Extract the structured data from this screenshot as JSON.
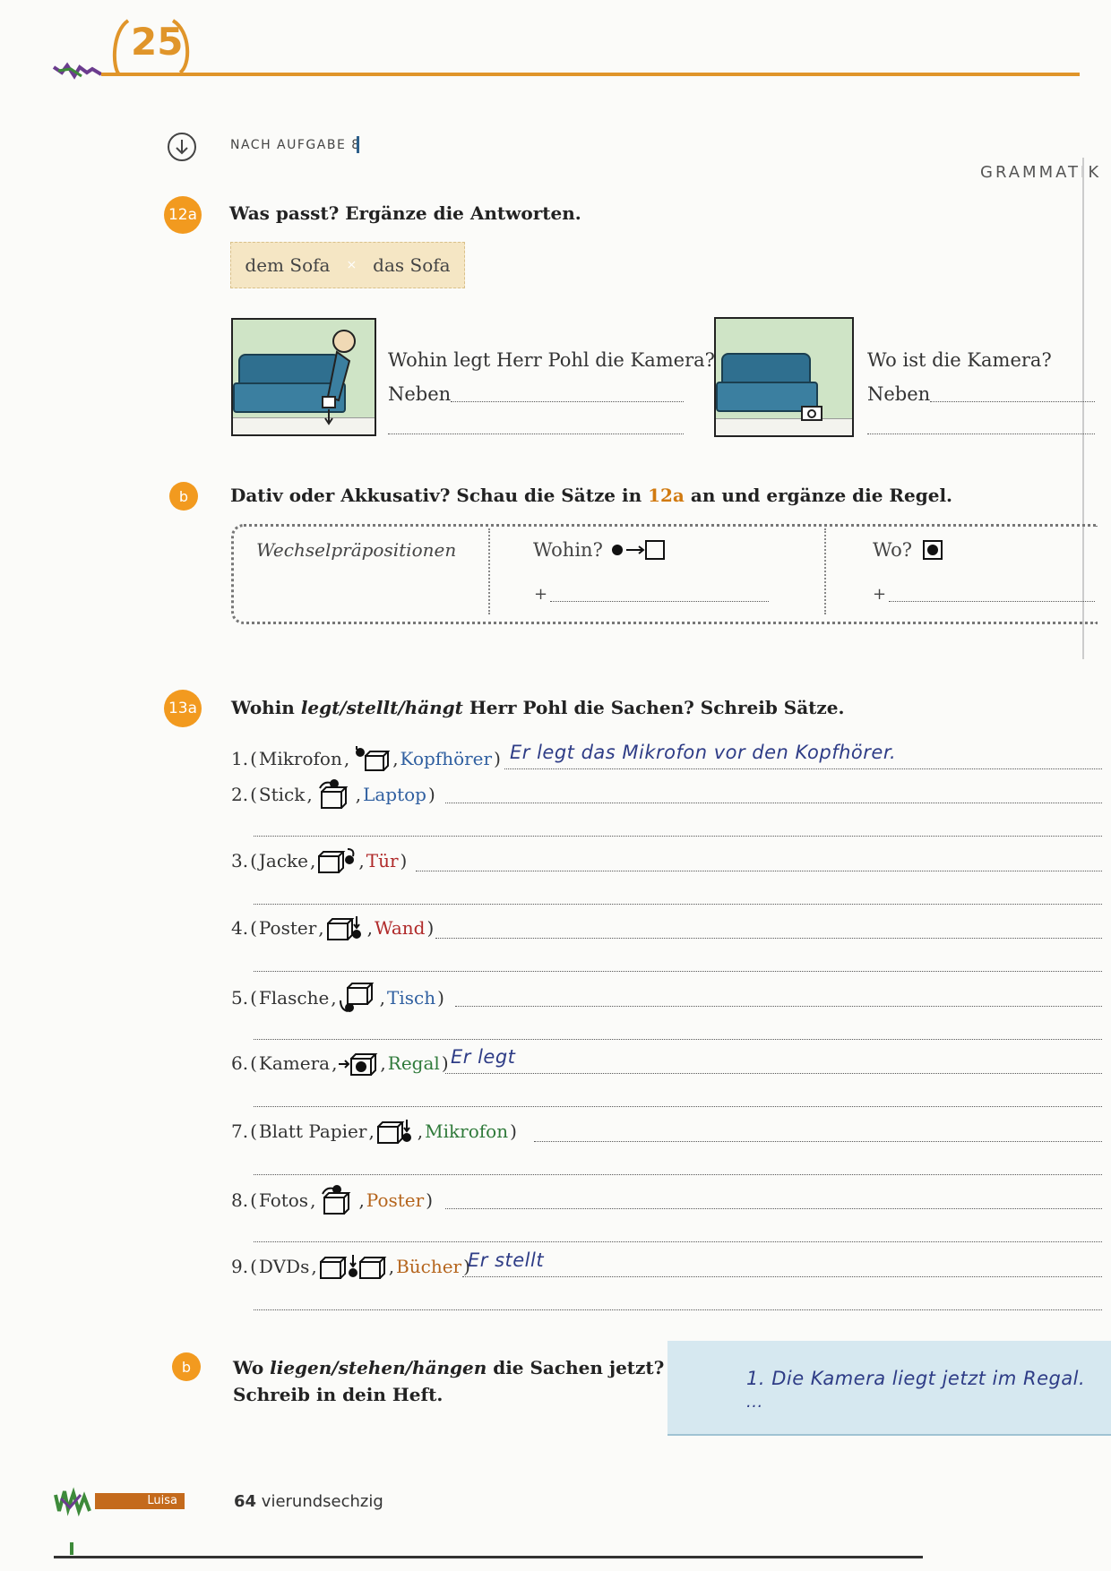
{
  "header": {
    "unit_number": "25",
    "section_label": "GRAMMATIK",
    "sidebar_label": "NACH AUFGABE 8"
  },
  "task_12a": {
    "badge": "12a",
    "title": "Was passt? Ergänze die Antworten.",
    "word_box": [
      "dem Sofa",
      "das Sofa"
    ],
    "word_sep": "×",
    "q1": {
      "question": "Wohin legt Herr Pohl die Kamera?",
      "prefix": "Neben"
    },
    "q2": {
      "question": "Wo ist die Kamera?",
      "prefix": "Neben"
    }
  },
  "task_12b": {
    "badge": "b",
    "title_before": "Dativ oder Akkusativ? Schau die Sätze in ",
    "title_ref": "12a",
    "title_after": " an und ergänze die Regel.",
    "col1": "Wechselpräpositionen",
    "col2": "Wohin?",
    "col3": "Wo?",
    "plus": "+"
  },
  "task_13a": {
    "badge": "13a",
    "title_pre": "Wohin ",
    "title_verbs": "legt/stellt/hängt",
    "title_post": " Herr Pohl die Sachen? Schreib Sätze.",
    "items": [
      {
        "num": "1.",
        "thing": "Mikrofon",
        "icon": "on-top",
        "ref": "Kopfhörer",
        "ref_color": "blue",
        "answer": "Er legt das Mikrofon vor den Kopfhörer."
      },
      {
        "num": "2.",
        "thing": "Stick",
        "icon": "above-arrow",
        "ref": "Laptop",
        "ref_color": "blue",
        "answer": ""
      },
      {
        "num": "3.",
        "thing": "Jacke",
        "icon": "right-side",
        "ref": "Tür",
        "ref_color": "red",
        "answer": ""
      },
      {
        "num": "4.",
        "thing": "Poster",
        "icon": "next-to",
        "ref": "Wand",
        "ref_color": "red",
        "answer": ""
      },
      {
        "num": "5.",
        "thing": "Flasche",
        "icon": "under",
        "ref": "Tisch",
        "ref_color": "blue",
        "answer": ""
      },
      {
        "num": "6.",
        "thing": "Kamera",
        "icon": "into",
        "ref": "Regal",
        "ref_color": "green",
        "answer": "Er legt"
      },
      {
        "num": "7.",
        "thing": "Blatt Papier",
        "icon": "next-to",
        "ref": "Mikrofon",
        "ref_color": "green",
        "answer": ""
      },
      {
        "num": "8.",
        "thing": "Fotos",
        "icon": "above-arrow",
        "ref": "Poster",
        "ref_color": "orange",
        "answer": ""
      },
      {
        "num": "9.",
        "thing": "DVDs",
        "icon": "between",
        "ref": "Bücher",
        "ref_color": "orange",
        "answer": "Er stellt"
      }
    ]
  },
  "task_13b": {
    "badge": "b",
    "title_pre": "Wo ",
    "title_verbs": "liegen/stehen/hängen",
    "title_post": " die Sachen jetzt?",
    "title_line2": "Schreib in dein Heft.",
    "example_line1": "1. Die Kamera liegt jetzt im Regal.",
    "example_line2": "..."
  },
  "footer": {
    "page_number": "64",
    "page_word": "vierundsechzig",
    "brand": "Luisa"
  },
  "colors": {
    "accent_orange": "#f29a1f",
    "header_line": "#e0952a",
    "handwriting": "#2e3c86",
    "word_box_bg": "#f5e6c4",
    "example_box_bg": "#d6e8f0"
  }
}
